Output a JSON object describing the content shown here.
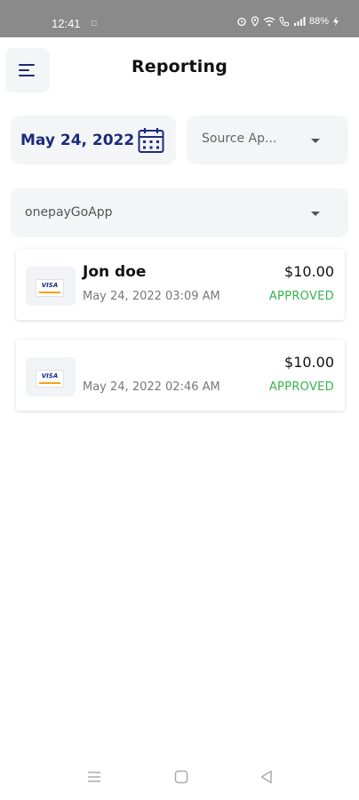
{
  "status_bar": {
    "time": "12:41",
    "battery": "88%"
  },
  "header": {
    "title": "Reporting",
    "menu_icon": "menu-icon"
  },
  "filters": {
    "date": "May 24, 2022",
    "source_label": "Source Ap...",
    "app_selected": "onepayGoApp"
  },
  "transactions": [
    {
      "card_brand": "VISA",
      "name": "Jon doe",
      "datetime": "May 24, 2022 03:09 AM",
      "amount": "$10.00",
      "status": "APPROVED"
    },
    {
      "card_brand": "VISA",
      "name": "",
      "datetime": "May 24, 2022 02:46 AM",
      "amount": "$10.00",
      "status": "APPROVED"
    }
  ],
  "colors": {
    "accent_navy": "#1d2b7a",
    "approved_green": "#37b24d",
    "field_bg": "#f4f5f7",
    "status_bar_bg": "#8a8a8a"
  }
}
